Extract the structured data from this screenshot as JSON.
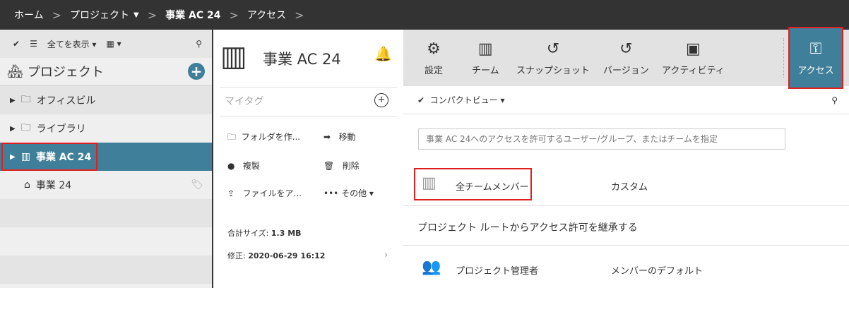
{
  "breadcrumb": [
    "ホーム",
    "プロジェクト",
    "事業 AC 24",
    "アクセス"
  ],
  "left": {
    "filter_label": "全てを表示",
    "header": "プロジェクト",
    "items": [
      {
        "label": "オフィスビル",
        "icon": "folder-icon"
      },
      {
        "label": "ライブラリ",
        "icon": "library-folder-icon"
      },
      {
        "label": "事業 AC 24",
        "icon": "building-icon",
        "selected": true
      },
      {
        "label": "事業 24",
        "icon": "house-icon"
      }
    ]
  },
  "mid": {
    "title": "事業 AC 24",
    "tags_label": "マイタグ",
    "actions": [
      "フォルダを作...",
      "移動",
      "複製",
      "削除",
      "ファイルをア...",
      "その他"
    ],
    "size_label": "合計サイズ:",
    "size_value": "1.3 MB",
    "modified_label": "修正:",
    "modified_value": "2020-06-29 16:12"
  },
  "right": {
    "tools": [
      "設定",
      "チーム",
      "スナップショット",
      "バージョン",
      "アクティビティ",
      "アクセス"
    ],
    "view_label": "コンパクトビュー",
    "search_placeholder": "事業 AC 24へのアクセスを許可するユーザー/グループ、またはチームを指定",
    "rows": [
      {
        "name": "全チームメンバー",
        "role": "カスタム"
      },
      {
        "name": "プロジェクト管理者",
        "role": "メンバーのデフォルト"
      }
    ],
    "inherit_label": "プロジェクト ルートからアクセス許可を継承する"
  },
  "colors": {
    "accent": "#3f7f99",
    "topbar": "#333333"
  }
}
